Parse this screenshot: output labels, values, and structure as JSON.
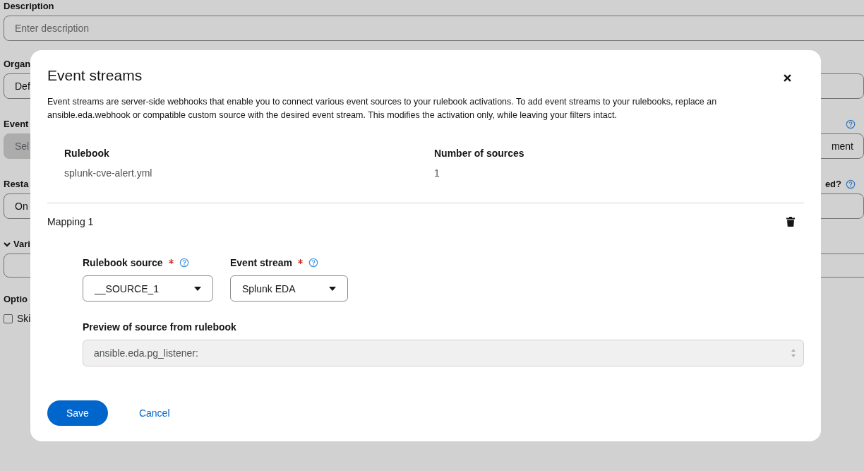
{
  "background": {
    "description": {
      "label": "Description",
      "placeholder": "Enter description"
    },
    "rows": [
      {
        "left": {
          "label": "Organ",
          "value": "Def",
          "disabled": false
        }
      },
      {
        "left": {
          "label": "Event",
          "value": "Sel",
          "disabled": true
        },
        "right": {
          "help": true,
          "value": "ment"
        }
      },
      {
        "left": {
          "label": "Resta",
          "value": "On",
          "disabled": false
        },
        "right": {
          "label": "ed?",
          "help": true
        }
      }
    ],
    "variables": {
      "label": "Vari",
      "expanded": true
    },
    "options": {
      "label": "Optio",
      "checkbox": {
        "label": "Ski",
        "checked": false
      }
    }
  },
  "modal": {
    "title": "Event streams",
    "description": "Event streams are server-side webhooks that enable you to connect various event sources to your rulebook activations. To add event streams to your rulebooks, replace an ansible.eda.webhook or compatible custom source with the desired event stream. This modifies the activation only, while leaving your filters intact.",
    "table": {
      "columns": [
        "Rulebook",
        "Number of sources"
      ],
      "rows": [
        [
          "splunk-cve-alert.yml",
          "1"
        ]
      ]
    },
    "mapping": {
      "title": "Mapping 1",
      "fields": [
        {
          "label": "Rulebook source",
          "required": true,
          "value": "__SOURCE_1"
        },
        {
          "label": "Event stream",
          "required": true,
          "value": "Splunk EDA"
        }
      ],
      "preview": {
        "label": "Preview of source from rulebook",
        "value": "ansible.eda.pg_listener:"
      }
    },
    "buttons": [
      {
        "label": "Save",
        "kind": "primary"
      },
      {
        "label": "Cancel",
        "kind": "link"
      }
    ]
  }
}
